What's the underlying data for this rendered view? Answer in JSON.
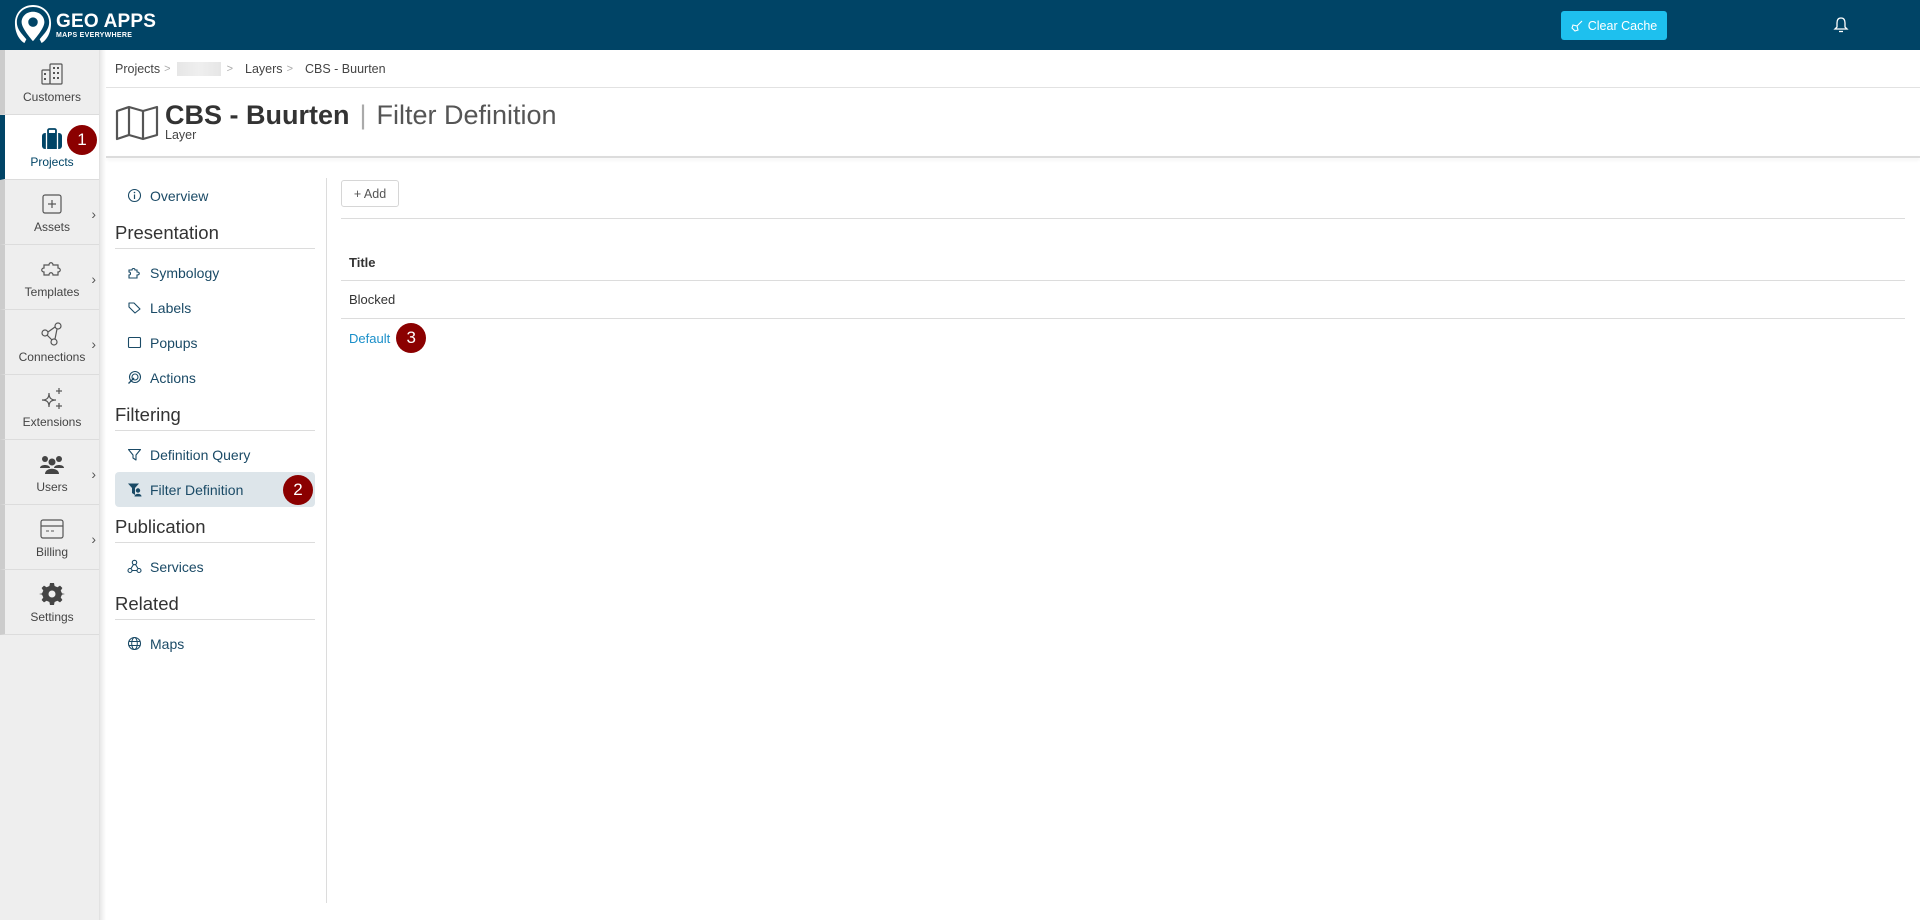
{
  "topbar": {
    "logo_title": "GEO APPS",
    "logo_subtitle": "MAPS EVERYWHERE",
    "clear_cache_label": "Clear Cache",
    "brand_color": "#004466",
    "accent_color": "#1ec0ee"
  },
  "leftnav": {
    "items": [
      {
        "label": "Customers",
        "icon": "buildings-icon",
        "has_chevron": false
      },
      {
        "label": "Projects",
        "icon": "briefcase-icon",
        "has_chevron": false,
        "active": true,
        "badge": "1"
      },
      {
        "label": "Assets",
        "icon": "plus-square-icon",
        "has_chevron": true
      },
      {
        "label": "Templates",
        "icon": "puzzle-icon",
        "has_chevron": true
      },
      {
        "label": "Connections",
        "icon": "network-icon",
        "has_chevron": true
      },
      {
        "label": "Extensions",
        "icon": "sparkle-icon",
        "has_chevron": false
      },
      {
        "label": "Users",
        "icon": "users-icon",
        "has_chevron": true
      },
      {
        "label": "Billing",
        "icon": "credit-card-icon",
        "has_chevron": true
      },
      {
        "label": "Settings",
        "icon": "gear-icon",
        "has_chevron": false
      }
    ]
  },
  "breadcrumb": {
    "items": [
      "Projects",
      "",
      "Layers",
      "CBS - Buurten"
    ],
    "separator": ">"
  },
  "header": {
    "title": "CBS - Buurten",
    "separator": "|",
    "subtitle": "Filter Definition",
    "type": "Layer"
  },
  "subnav": {
    "overview": "Overview",
    "sections": [
      {
        "title": "Presentation",
        "items": [
          "Symbology",
          "Labels",
          "Popups",
          "Actions"
        ]
      },
      {
        "title": "Filtering",
        "items": [
          "Definition Query",
          "Filter Definition"
        ]
      },
      {
        "title": "Publication",
        "items": [
          "Services"
        ]
      },
      {
        "title": "Related",
        "items": [
          "Maps"
        ]
      }
    ],
    "active_item": "Filter Definition",
    "active_badge": "2"
  },
  "main": {
    "add_label": "+ Add",
    "table": {
      "columns": [
        "Title"
      ],
      "rows": [
        {
          "title": "Blocked",
          "link": false
        },
        {
          "title": "Default",
          "link": true,
          "badge": "3"
        }
      ]
    }
  },
  "badge_color": "#8b0000"
}
